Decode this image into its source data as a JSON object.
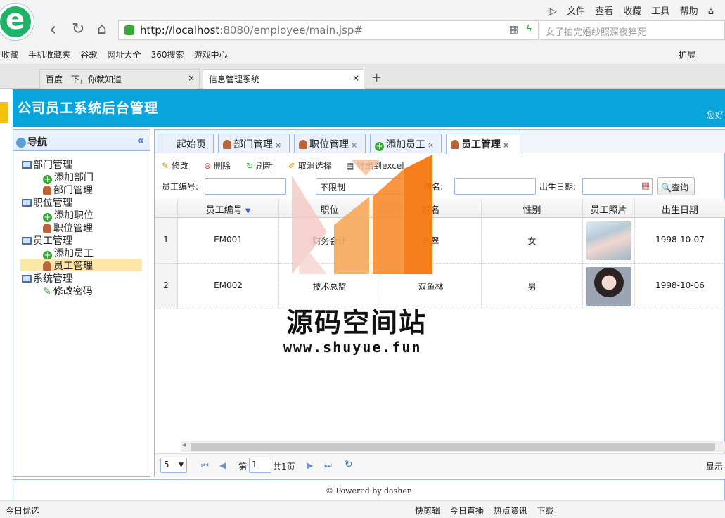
{
  "browser": {
    "menu": [
      "文件",
      "查看",
      "收藏",
      "工具",
      "帮助"
    ],
    "address_host": "http://localhost",
    "address_rest": ":8080/employee/main.jsp#",
    "search_placeholder": "女子拍完婚纱照深夜猝死",
    "favorites": [
      "收藏",
      "手机收藏夹",
      "谷歌",
      "网址大全",
      "360搜索",
      "游戏中心"
    ],
    "extensions_label": "扩展",
    "tabs": [
      {
        "title": "百度一下，你就知道"
      },
      {
        "title": "信息管理系统"
      }
    ],
    "status_left": "今日优选",
    "status_right": [
      "快剪辑",
      "今日直播",
      "热点资讯",
      "下载"
    ]
  },
  "app": {
    "title": "公司员工系统后台管理",
    "greeting": "您好",
    "nav_title": "导航",
    "tree": [
      {
        "label": "部门管理",
        "kind": "folder"
      },
      {
        "label": "添加部门",
        "kind": "add"
      },
      {
        "label": "部门管理",
        "kind": "person"
      },
      {
        "label": "职位管理",
        "kind": "folder"
      },
      {
        "label": "添加职位",
        "kind": "add"
      },
      {
        "label": "职位管理",
        "kind": "person"
      },
      {
        "label": "员工管理",
        "kind": "folder"
      },
      {
        "label": "添加员工",
        "kind": "add"
      },
      {
        "label": "员工管理",
        "kind": "person",
        "selected": true
      },
      {
        "label": "系统管理",
        "kind": "folder"
      },
      {
        "label": "修改密码",
        "kind": "pen"
      }
    ],
    "tabs": [
      "起始页",
      "部门管理",
      "职位管理",
      "添加员工",
      "员工管理"
    ],
    "toolbar": [
      "修改",
      "删除",
      "刷新",
      "取消选择",
      "导出到excel"
    ],
    "filters": {
      "emp_no_label": "员工编号:",
      "position_value": "不限制",
      "name_label": "姓名:",
      "birth_label": "出生日期:",
      "query_label": "查询"
    },
    "columns": [
      "员工编号",
      "职位",
      "姓名",
      "性别",
      "员工照片",
      "出生日期"
    ],
    "rows": [
      {
        "n": "1",
        "no": "EM001",
        "pos": "财务会计",
        "name": "珠翠",
        "sex": "女",
        "birth": "1998-10-07"
      },
      {
        "n": "2",
        "no": "EM002",
        "pos": "技术总监",
        "name": "双鱼林",
        "sex": "男",
        "birth": "1998-10-06"
      }
    ],
    "pager": {
      "size": "5",
      "page_prefix": "第",
      "page": "1",
      "page_total": "共1页",
      "display": "显示"
    },
    "footer": "© Powered by dashen"
  },
  "watermark": {
    "title": "源码空间站",
    "url": "www.shuyue.fun"
  }
}
